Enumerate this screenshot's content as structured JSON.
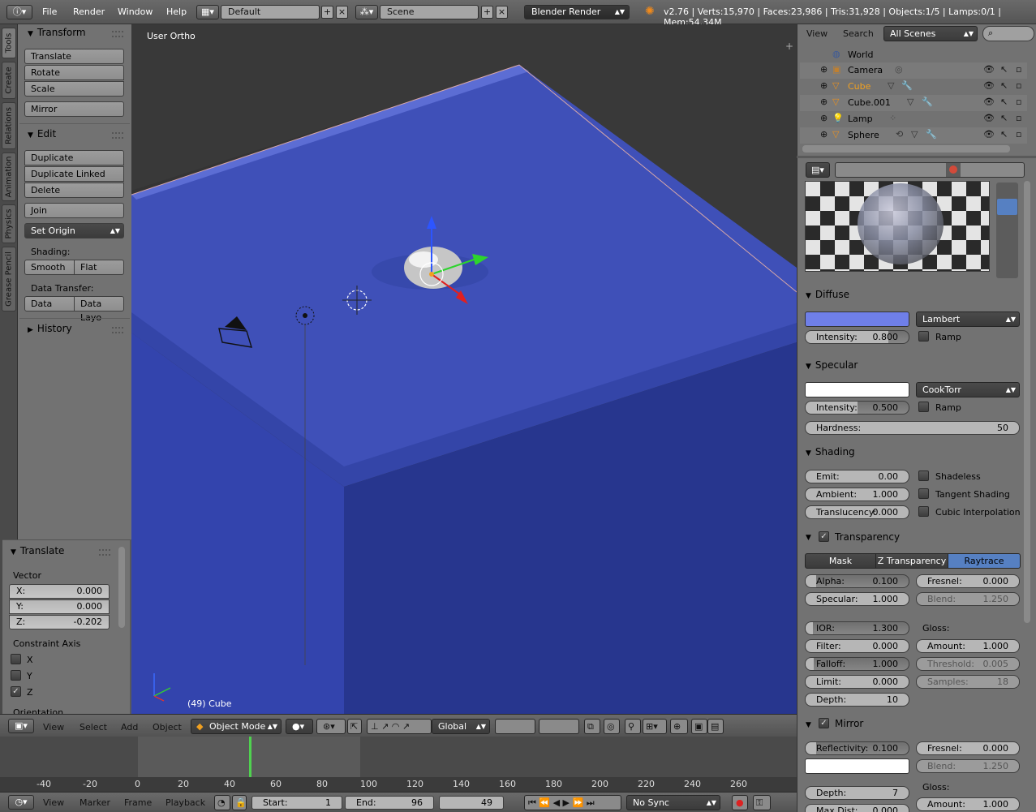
{
  "topbar": {
    "menus": [
      "File",
      "Render",
      "Window",
      "Help"
    ],
    "layout": "Default",
    "scene": "Scene",
    "engine": "Blender Render",
    "stats": "v2.76 | Verts:15,970 | Faces:23,986 | Tris:31,928 | Objects:1/5 | Lamps:0/1 | Mem:54.34M"
  },
  "tabs": [
    "Tools",
    "Create",
    "Relations",
    "Animation",
    "Physics",
    "Grease Pencil"
  ],
  "tools": {
    "transform_header": "Transform",
    "translate": "Translate",
    "rotate": "Rotate",
    "scale": "Scale",
    "mirror": "Mirror",
    "edit_header": "Edit",
    "duplicate": "Duplicate",
    "duplicate_linked": "Duplicate Linked",
    "delete": "Delete",
    "join": "Join",
    "set_origin": "Set Origin",
    "shading_label": "Shading:",
    "smooth": "Smooth",
    "flat": "Flat",
    "data_transfer_label": "Data Transfer:",
    "data": "Data",
    "data_layout": "Data Layo",
    "history_header": "History"
  },
  "operator": {
    "header": "Translate",
    "vector_label": "Vector",
    "x_label": "X:",
    "x_value": "0.000",
    "y_label": "Y:",
    "y_value": "0.000",
    "z_label": "Z:",
    "z_value": "-0.202",
    "constraint_label": "Constraint Axis",
    "cx": "X",
    "cy": "Y",
    "cz": "Z",
    "orientation_label": "Orientation"
  },
  "viewport": {
    "view_name": "User Ortho",
    "object_label": "(49) Cube"
  },
  "vheader": {
    "menus": [
      "View",
      "Select",
      "Add",
      "Object"
    ],
    "mode": "Object Mode",
    "orientation": "Global"
  },
  "timeline": {
    "ticks": [
      "-40",
      "-20",
      "0",
      "20",
      "40",
      "60",
      "80",
      "100",
      "120",
      "140",
      "160",
      "180",
      "200",
      "220",
      "240",
      "260"
    ],
    "menus": [
      "View",
      "Marker",
      "Frame",
      "Playback"
    ],
    "start_label": "Start:",
    "start": "1",
    "end_label": "End:",
    "end": "96",
    "current": "49",
    "sync": "No Sync",
    "current_frame": 49
  },
  "outliner": {
    "view": "View",
    "search": "Search",
    "scenes": "All Scenes",
    "items": [
      "World",
      "Camera",
      "Cube",
      "Cube.001",
      "Lamp",
      "Sphere"
    ]
  },
  "properties": {
    "diffuse": {
      "header": "Diffuse",
      "shader": "Lambert",
      "intensity_label": "Intensity:",
      "intensity": "0.800",
      "ramp": "Ramp",
      "color": "#6f7fe8"
    },
    "specular": {
      "header": "Specular",
      "shader": "CookTorr",
      "intensity_label": "Intensity:",
      "intensity": "0.500",
      "ramp": "Ramp",
      "hardness_label": "Hardness:",
      "hardness": "50",
      "color": "#ffffff"
    },
    "shading": {
      "header": "Shading",
      "emit_label": "Emit:",
      "emit": "0.00",
      "ambient_label": "Ambient:",
      "ambient": "1.000",
      "translucency_label": "Translucency:",
      "translucency": "0.000",
      "shadeless": "Shadeless",
      "tangent": "Tangent Shading",
      "cubic": "Cubic Interpolation"
    },
    "transparency": {
      "header": "Transparency",
      "tabs": [
        "Mask",
        "Z Transparency",
        "Raytrace"
      ],
      "alpha_label": "Alpha:",
      "alpha": "0.100",
      "specular_label": "Specular:",
      "specular": "1.000",
      "fresnel_label": "Fresnel:",
      "fresnel": "0.000",
      "blend_label": "Blend:",
      "blend": "1.250",
      "ior_label": "IOR:",
      "ior": "1.300",
      "filter_label": "Filter:",
      "filter": "0.000",
      "falloff_label": "Falloff:",
      "falloff": "1.000",
      "limit_label": "Limit:",
      "limit": "0.000",
      "depth_label": "Depth:",
      "depth": "10",
      "gloss_label": "Gloss:",
      "amount_label": "Amount:",
      "amount": "1.000",
      "threshold_label": "Threshold:",
      "threshold": "0.005",
      "samples_label": "Samples:",
      "samples": "18"
    },
    "mirror": {
      "header": "Mirror",
      "reflectivity_label": "Reflectivity:",
      "reflectivity": "0.100",
      "fresnel_label": "Fresnel:",
      "fresnel": "0.000",
      "blend_label": "Blend:",
      "blend": "1.250",
      "depth_label": "Depth:",
      "depth": "7",
      "gloss_label": "Gloss:",
      "maxdist_label": "Max Dist:",
      "maxdist": "0.000",
      "amount_label": "Amount:",
      "amount": "1.000",
      "color": "#ffffff"
    }
  },
  "colors": {
    "accent": "#5680c2",
    "cube": "#3c4bb8"
  }
}
